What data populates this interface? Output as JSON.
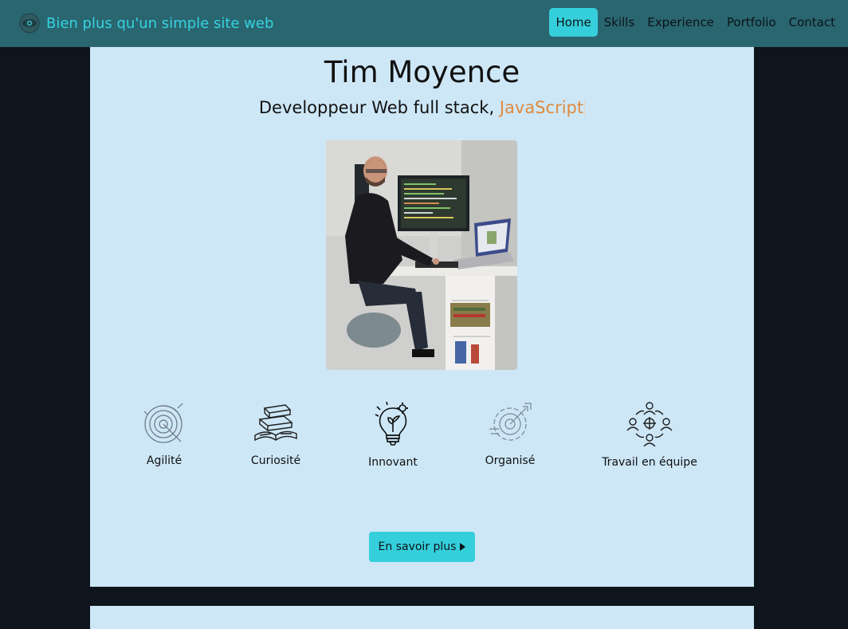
{
  "navbar": {
    "brand_text": "Bien plus qu'un simple site web",
    "brand_logo_icon": "eye-logo-icon",
    "links": [
      {
        "label": "Home",
        "active": true
      },
      {
        "label": "Skills",
        "active": false
      },
      {
        "label": "Experience",
        "active": false
      },
      {
        "label": "Portfolio",
        "active": false
      },
      {
        "label": "Contact",
        "active": false
      }
    ]
  },
  "hero": {
    "name": "Tim Moyence",
    "subtitle_prefix": "Developpeur Web full stack, ",
    "subtitle_accent": "JavaScript",
    "photo_icon": "profile-photo",
    "qualities": [
      {
        "label": "Agilité",
        "icon": "spiral-target-icon"
      },
      {
        "label": "Curiosité",
        "icon": "books-icon"
      },
      {
        "label": "Innovant",
        "icon": "lightbulb-icon"
      },
      {
        "label": "Organisé",
        "icon": "target-arrow-icon"
      },
      {
        "label": "Travail en équipe",
        "icon": "team-network-icon"
      }
    ],
    "cta_label": "En savoir plus"
  },
  "colors": {
    "page_bg": "#0f151d",
    "navbar_bg": "#2a6670",
    "accent_cyan": "#35cfdb",
    "hero_bg": "#cde7f7",
    "accent_orange": "#e08a3c"
  }
}
